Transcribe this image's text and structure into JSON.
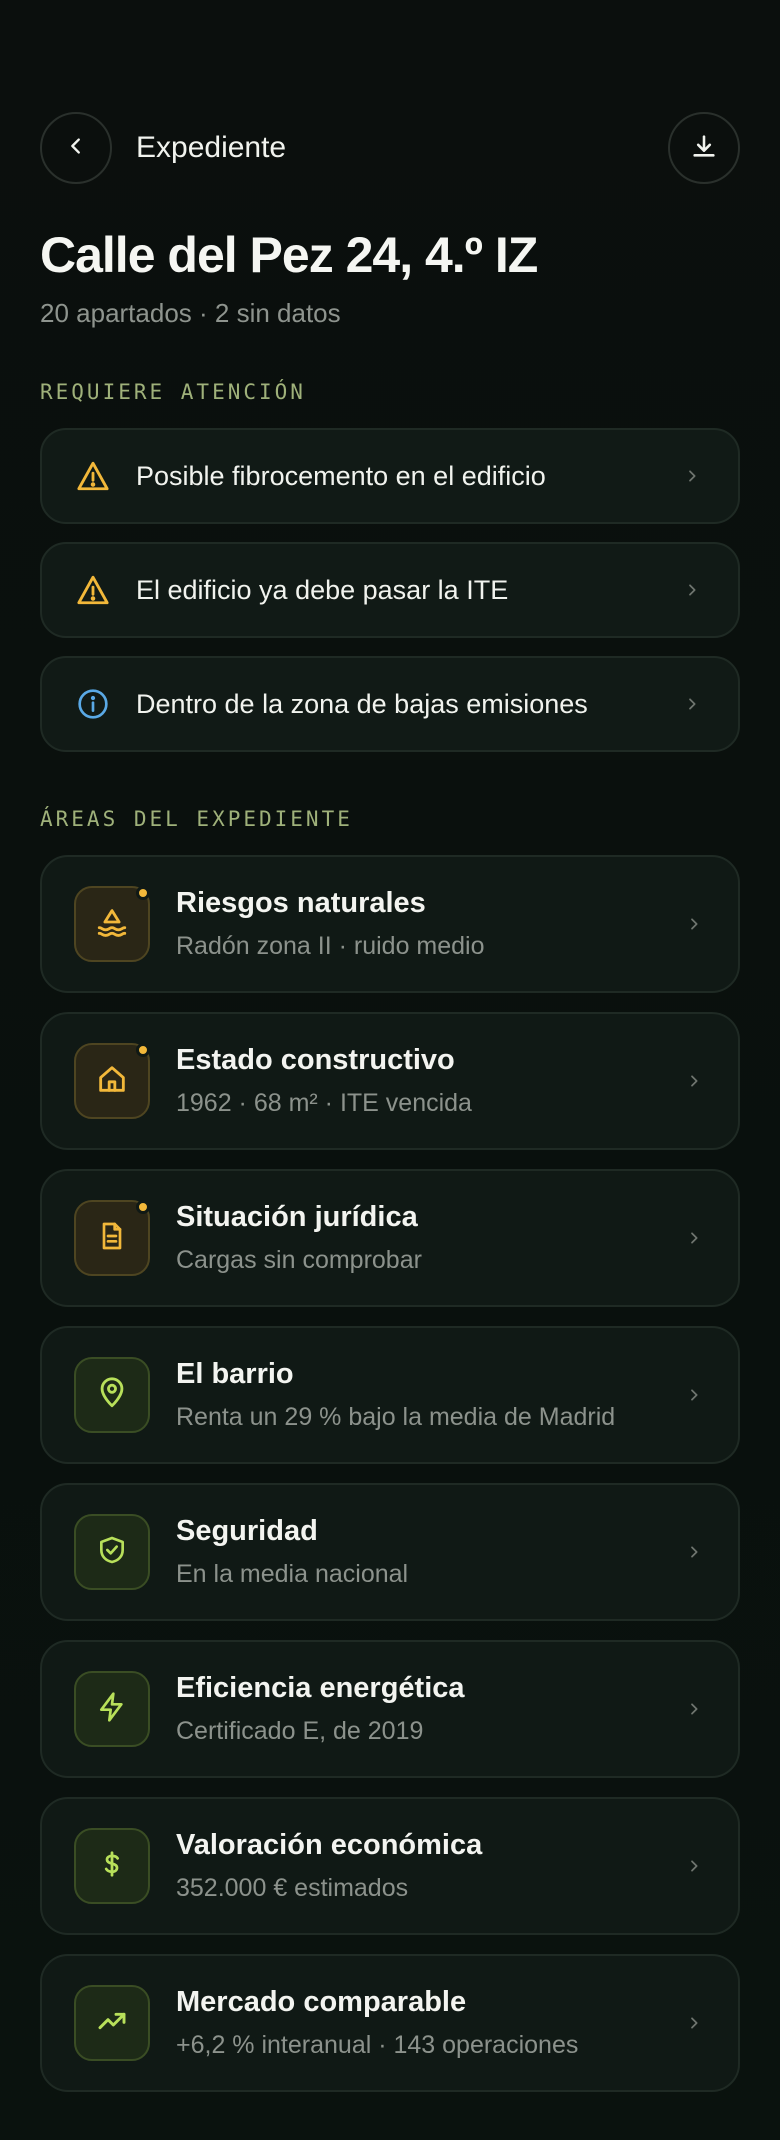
{
  "header": {
    "title": "Expediente",
    "back_icon": "chevron-left-icon",
    "download_icon": "download-icon"
  },
  "property": {
    "address": "Calle del Pez 24, 4.º IZ",
    "summary": "20 apartados · 2 sin datos"
  },
  "attention": {
    "label": "REQUIERE ATENCIÓN",
    "items": [
      {
        "text": "Posible fibrocemento en el edificio",
        "icon": "warning-icon",
        "color": "#f2b83a"
      },
      {
        "text": "El edificio ya debe pasar la ITE",
        "icon": "warning-icon",
        "color": "#f2b83a"
      },
      {
        "text": "Dentro de la zona de bajas emisiones",
        "icon": "info-icon",
        "color": "#5aa9e6"
      }
    ]
  },
  "areas": {
    "label": "ÁREAS DEL EXPEDIENTE",
    "items": [
      {
        "name": "Riesgos naturales",
        "desc": "Radón zona II · ruido medio",
        "icon": "hazard-icon",
        "status": "warning"
      },
      {
        "name": "Estado constructivo",
        "desc": "1962 · 68 m² · ITE vencida",
        "icon": "house-icon",
        "status": "warning"
      },
      {
        "name": "Situación jurídica",
        "desc": "Cargas sin comprobar",
        "icon": "document-icon",
        "status": "warning"
      },
      {
        "name": "El barrio",
        "desc": "Renta un 29 % bajo la media de Madrid",
        "icon": "map-pin-icon",
        "status": "ok"
      },
      {
        "name": "Seguridad",
        "desc": "En la media nacional",
        "icon": "shield-check-icon",
        "status": "ok"
      },
      {
        "name": "Eficiencia energética",
        "desc": "Certificado E, de 2019",
        "icon": "lightning-icon",
        "status": "ok"
      },
      {
        "name": "Valoración económica",
        "desc": "352.000 € estimados",
        "icon": "dollar-icon",
        "status": "ok"
      },
      {
        "name": "Mercado comparable",
        "desc": "+6,2 % interanual · 143 operaciones",
        "icon": "trending-up-icon",
        "status": "ok"
      }
    ]
  },
  "colors": {
    "warning": "#f2b83a",
    "info": "#5aa9e6",
    "ok": "#b8e05a",
    "accent_label": "#9fb17a"
  }
}
